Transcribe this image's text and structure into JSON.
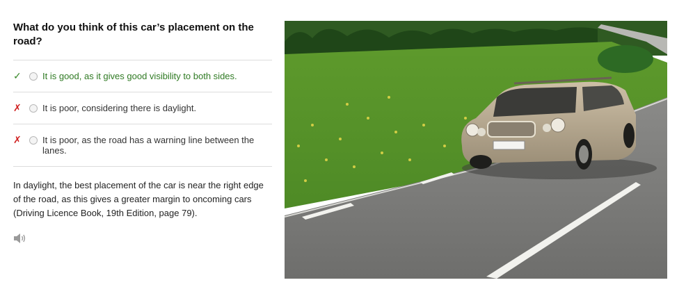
{
  "question": {
    "title": "What do you think of this car’s placement on the road?"
  },
  "options": [
    {
      "mark": "✓",
      "text": "It is good, as it gives good visibility to both sides.",
      "correct": true
    },
    {
      "mark": "✗",
      "text": "It is poor, considering there is daylight.",
      "correct": false
    },
    {
      "mark": "✗",
      "text": "It is poor, as the road has a warning line between the lanes.",
      "correct": false
    }
  ],
  "explanation": {
    "text": "In daylight, the best placement of the car is near the right edge of the road, as this gives a greater margin to oncoming cars (Driving Licence Book, 19th Edition, page 79)."
  },
  "icons": {
    "audio": "speaker-icon"
  },
  "colors": {
    "correct": "#2f7a23",
    "wrong_mark": "#d02020",
    "divider": "#dcdcdc"
  }
}
